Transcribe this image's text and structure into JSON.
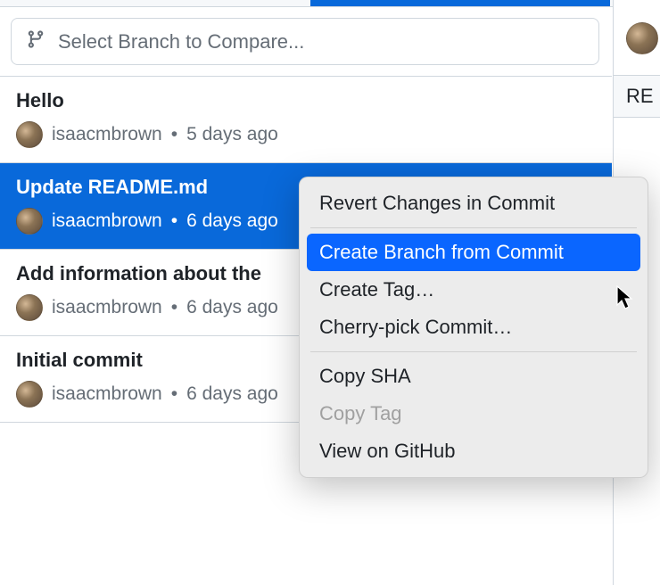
{
  "branch_selector": {
    "placeholder": "Select Branch to Compare..."
  },
  "commits": [
    {
      "title": "Hello",
      "author": "isaacmbrown",
      "time": "5 days ago",
      "selected": false
    },
    {
      "title": "Update README.md",
      "author": "isaacmbrown",
      "time": "6 days ago",
      "selected": true
    },
    {
      "title": "Add information about the",
      "author": "isaacmbrown",
      "time": "6 days ago",
      "selected": false
    },
    {
      "title": "Initial commit",
      "author": "isaacmbrown",
      "time": "6 days ago",
      "selected": false
    }
  ],
  "right_panel": {
    "label": "RE"
  },
  "context_menu": {
    "items": [
      {
        "label": "Revert Changes in Commit",
        "highlighted": false,
        "disabled": false
      },
      {
        "divider": true
      },
      {
        "label": "Create Branch from Commit",
        "highlighted": true,
        "disabled": false
      },
      {
        "label": "Create Tag…",
        "highlighted": false,
        "disabled": false
      },
      {
        "label": "Cherry-pick Commit…",
        "highlighted": false,
        "disabled": false
      },
      {
        "divider": true
      },
      {
        "label": "Copy SHA",
        "highlighted": false,
        "disabled": false
      },
      {
        "label": "Copy Tag",
        "highlighted": false,
        "disabled": true
      },
      {
        "label": "View on GitHub",
        "highlighted": false,
        "disabled": false
      }
    ]
  },
  "separator": "•"
}
